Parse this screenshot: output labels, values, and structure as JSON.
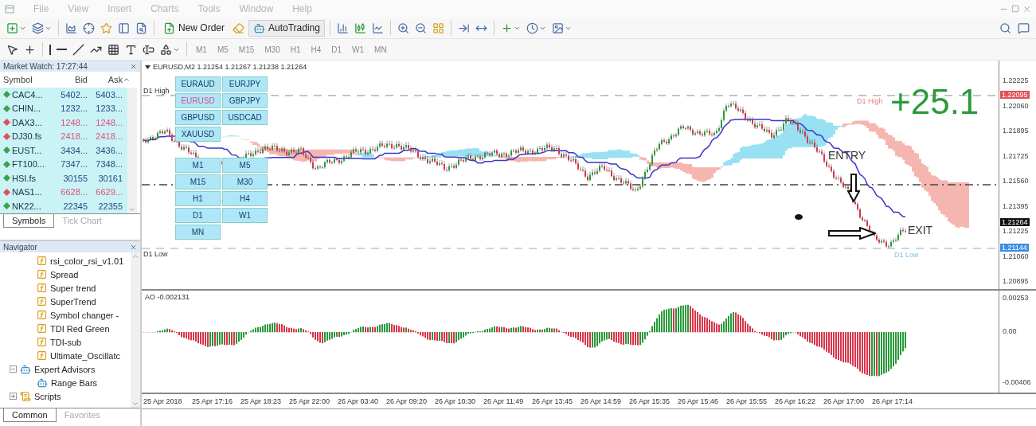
{
  "menu": [
    "File",
    "View",
    "Insert",
    "Charts",
    "Tools",
    "Window",
    "Help"
  ],
  "toolbar": {
    "new_order": "New Order",
    "auto_trading": "AutoTrading"
  },
  "drawing_toolbar": {
    "timeframes": [
      {
        "label": "M1",
        "disabled": true
      },
      {
        "label": "M5",
        "disabled": true
      },
      {
        "label": "M15",
        "disabled": true
      },
      {
        "label": "M30",
        "disabled": true
      },
      {
        "label": "H1",
        "disabled": true
      },
      {
        "label": "H4",
        "disabled": true
      },
      {
        "label": "D1",
        "disabled": true
      },
      {
        "label": "W1",
        "disabled": true
      },
      {
        "label": "MN",
        "disabled": true
      }
    ]
  },
  "market_watch": {
    "title": "Market Watch: 17:27:44",
    "columns": [
      "Symbol",
      "Bid",
      "Ask"
    ],
    "rows": [
      {
        "symbol": "CAC4...",
        "bid": "5402...",
        "ask": "5403...",
        "rising": true
      },
      {
        "symbol": "CHIN...",
        "bid": "1232...",
        "ask": "1233...",
        "rising": true
      },
      {
        "symbol": "DAX3...",
        "bid": "1248...",
        "ask": "1248...",
        "rising": false
      },
      {
        "symbol": "DJ30.fs",
        "bid": "2418...",
        "ask": "2418...",
        "rising": false
      },
      {
        "symbol": "EUST...",
        "bid": "3434...",
        "ask": "3436...",
        "rising": true
      },
      {
        "symbol": "FT100...",
        "bid": "7347...",
        "ask": "7348...",
        "rising": true
      },
      {
        "symbol": "HSI.fs",
        "bid": "30155",
        "ask": "30161",
        "rising": true
      },
      {
        "symbol": "NAS1...",
        "bid": "6628...",
        "ask": "6629...",
        "rising": false
      },
      {
        "symbol": "NK22...",
        "bid": "22345",
        "ask": "22355",
        "rising": true
      }
    ],
    "tabs": [
      {
        "label": "Symbols",
        "selected": true
      },
      {
        "label": "Tick Chart",
        "selected": false
      }
    ]
  },
  "navigator": {
    "title": "Navigator",
    "indicators": [
      "rsi_color_rsi_v1.01",
      "Spread",
      "Super trend",
      "SuperTrend",
      "Symbol changer -",
      "TDI Red Green",
      "TDI-sub",
      "Ultimate_Oscillatc"
    ],
    "folders": [
      {
        "label": "Expert Advisors",
        "kind": "experts",
        "expanded": true,
        "children": [
          {
            "label": "Range Bars",
            "kind": "expert"
          }
        ]
      },
      {
        "label": "Scripts",
        "kind": "scripts",
        "expanded": false
      }
    ],
    "tabs": [
      {
        "label": "Common",
        "selected": true
      },
      {
        "label": "Favorites",
        "selected": false
      }
    ]
  },
  "chart": {
    "symbol": "EURUSD,M2",
    "ohlc": "1.21254 1.21267 1.21238 1.21264",
    "symbol_buttons": [
      {
        "label": "EURAUD",
        "selected": false
      },
      {
        "label": "EURJPY",
        "selected": false
      },
      {
        "label": "EURUSD",
        "selected": true
      },
      {
        "label": "GBPJPY",
        "selected": false
      },
      {
        "label": "GBPUSD",
        "selected": false
      },
      {
        "label": "USDCAD",
        "selected": false
      },
      {
        "label": "XAUUSD",
        "selected": false
      }
    ],
    "timeframe_buttons": [
      "M1",
      "M5",
      "M15",
      "M30",
      "H1",
      "H4",
      "D1",
      "W1",
      "MN"
    ],
    "d1_high": {
      "left_label": "D1 High",
      "right_label": "D1 High"
    },
    "d1_low": {
      "left_label": "D1 Low",
      "right_label": "D1 Low"
    },
    "profit": "+25.1",
    "entry": "ENTRY",
    "exit": "EXIT",
    "price_axis": {
      "ticks": [
        "1.22225",
        "1.22060",
        "1.21895",
        "1.21725",
        "1.21560",
        "1.21395",
        "1.21225",
        "1.21060",
        "1.20895"
      ],
      "markers": [
        {
          "label": "1.22095",
          "color": "#e0505a"
        },
        {
          "label": "1.21264",
          "color": "#111111"
        },
        {
          "label": "1.21144",
          "color": "#3a8ee0"
        }
      ]
    }
  },
  "oscillator": {
    "title": "AO -0.002131",
    "axis": [
      "0.00253",
      "0.00",
      "-0.00406"
    ]
  },
  "time_axis": [
    "25 Apr 2018",
    "25 Apr 17:16",
    "25 Apr 18:23",
    "25 Apr 22:00",
    "26 Apr 03:40",
    "26 Apr 09:20",
    "26 Apr 10:30",
    "26 Apr 11:49",
    "26 Apr 13:45",
    "26 Apr 14:59",
    "26 Apr 15:35",
    "26 Apr 15:46",
    "26 Apr 15:55",
    "26 Apr 16:22",
    "26 Apr 17:00",
    "26 Apr 17:14"
  ]
}
